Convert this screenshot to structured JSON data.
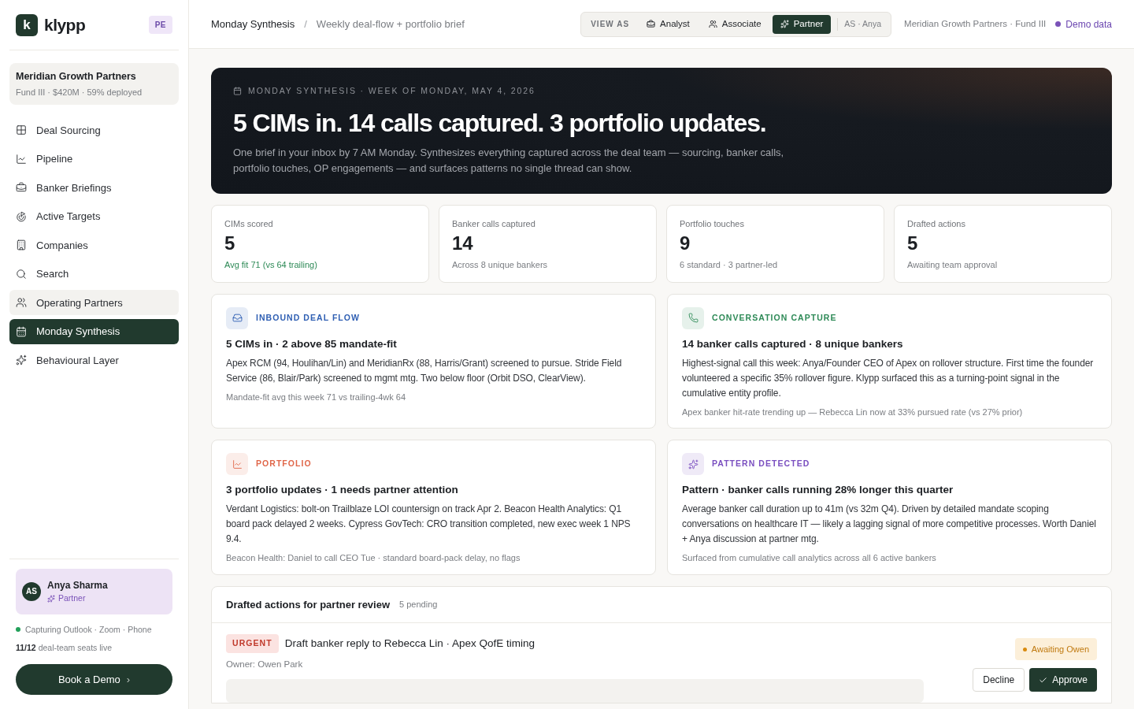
{
  "sidebar": {
    "logo": {
      "mark": "k",
      "name": "klypp",
      "badge": "PE"
    },
    "fund": {
      "name": "Meridian Growth Partners",
      "details": "Fund III · $420M · 59% deployed"
    },
    "items": [
      {
        "label": "Deal Sourcing",
        "selected": false,
        "hovered": false
      },
      {
        "label": "Pipeline",
        "selected": false,
        "hovered": false
      },
      {
        "label": "Banker Briefings",
        "selected": false,
        "hovered": false
      },
      {
        "label": "Active Targets",
        "selected": false,
        "hovered": false
      },
      {
        "label": "Companies",
        "selected": false,
        "hovered": false
      },
      {
        "label": "Search",
        "selected": false,
        "hovered": false
      },
      {
        "label": "Operating Partners",
        "selected": false,
        "hovered": true
      },
      {
        "label": "Monday Synthesis",
        "selected": true,
        "hovered": false
      },
      {
        "label": "Behavioural Layer",
        "selected": false,
        "hovered": false
      }
    ],
    "user": {
      "initials": "AS",
      "name": "Anya Sharma",
      "role": "Partner"
    },
    "capture": {
      "text": "Capturing Outlook · Zoom · Phone",
      "color": "#22a05a"
    },
    "seats": {
      "count": "11/12",
      "text": "deal-team seats live"
    },
    "cta": "Book a Demo",
    "cta_arrow": "›"
  },
  "topbar": {
    "breadcrumb": [
      "Monday Synthesis",
      "Weekly deal-flow + portfolio brief"
    ],
    "separator": "/",
    "view_as": {
      "label": "VIEW AS",
      "options": [
        {
          "label": "Analyst",
          "selected": false
        },
        {
          "label": "Associate",
          "selected": false
        },
        {
          "label": "Partner",
          "selected": true
        }
      ],
      "user": "AS · Anya"
    },
    "fund": "Meridian Growth Partners · Fund III",
    "demo": "Demo data"
  },
  "hero": {
    "eyebrow": "MONDAY SYNTHESIS · WEEK OF MONDAY, MAY 4, 2026",
    "title": "5 CIMs in. 14 calls captured. 3 portfolio updates.",
    "body": "One brief in your inbox by 7 AM Monday. Synthesizes everything captured across the deal team — sourcing, banker calls, portfolio touches, OP engagements — and surfaces patterns no single thread can show."
  },
  "stats": [
    {
      "label": "CIMs scored",
      "value": "5",
      "note": "Avg fit 71 (vs 64 trailing)",
      "positive": true
    },
    {
      "label": "Banker calls captured",
      "value": "14",
      "note": "Across 8 unique bankers",
      "positive": false
    },
    {
      "label": "Portfolio touches",
      "value": "9",
      "note": "6 standard · 3 partner-led",
      "positive": false
    },
    {
      "label": "Drafted actions",
      "value": "5",
      "note": "Awaiting team approval",
      "positive": false
    }
  ],
  "insights": [
    {
      "kind": "inbox",
      "color": "#2f5fb3",
      "tag": "INBOUND DEAL FLOW",
      "title": "5 CIMs in · 2 above 85 mandate-fit",
      "body": "Apex RCM (94, Houlihan/Lin) and MeridianRx (88, Harris/Grant) screened to pursue. Stride Field Service (86, Blair/Park) screened to mgmt mtg. Two below floor (Orbit DSO, ClearView).",
      "footer": "Mandate-fit avg this week 71 vs trailing-4wk 64"
    },
    {
      "kind": "phone",
      "color": "#2e8a57",
      "tag": "CONVERSATION CAPTURE",
      "title": "14 banker calls captured · 8 unique bankers",
      "body": "Highest-signal call this week: Anya/Founder CEO of Apex on rollover structure. First time the founder volunteered a specific 35% rollover figure. Klypp surfaced this as a turning-point signal in the cumulative entity profile.",
      "footer": "Apex banker hit-rate trending up — Rebecca Lin now at 33% pursued rate (vs 27% prior)"
    },
    {
      "kind": "chart",
      "color": "#e0674a",
      "tag": "PORTFOLIO",
      "title": "3 portfolio updates · 1 needs partner attention",
      "body": "Verdant Logistics: bolt-on Trailblaze LOI countersign on track Apr 2. Beacon Health Analytics: Q1 board pack delayed 2 weeks. Cypress GovTech: CRO transition completed, new exec week 1 NPS 9.4.",
      "footer": "Beacon Health: Daniel to call CEO Tue · standard board-pack delay, no flags"
    },
    {
      "kind": "sparkle",
      "color": "#7a4fc0",
      "tag": "PATTERN DETECTED",
      "title": "Pattern · banker calls running 28% longer this quarter",
      "body": "Average banker call duration up to 41m (vs 32m Q4). Driven by detailed mandate scoping conversations on healthcare IT — likely a lagging signal of more competitive processes. Worth Daniel + Anya discussion at partner mtg.",
      "footer": "Surfaced from cumulative call analytics across all 6 active bankers"
    }
  ],
  "actions": {
    "title": "Drafted actions for partner review",
    "count": "5 pending",
    "items": [
      {
        "badge": "URGENT",
        "title": "Draft banker reply to Rebecca Lin · Apex QofE timing",
        "owner": "Owner: Owen Park",
        "status": "Awaiting Owen",
        "decline": "Decline",
        "approve": "Approve"
      }
    ]
  }
}
